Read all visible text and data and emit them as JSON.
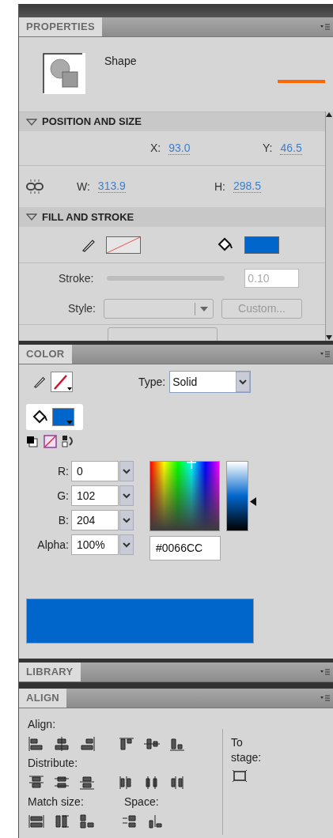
{
  "properties": {
    "tab": "PROPERTIES",
    "shape_label": "Shape",
    "position": {
      "title": "POSITION AND SIZE",
      "fields": [
        {
          "label": "X:",
          "value": "93.0"
        },
        {
          "label": "Y:",
          "value": "46.5"
        },
        {
          "label": "W:",
          "value": "313.9"
        },
        {
          "label": "H:",
          "value": "298.5"
        }
      ]
    },
    "fill_stroke": {
      "title": "FILL AND STROKE",
      "stroke_label": "Stroke:",
      "stroke_value": "0.10",
      "style_label": "Style:",
      "custom_button": "Custom..."
    }
  },
  "color": {
    "tab": "COLOR",
    "type_label": "Type:",
    "type_value": "Solid",
    "channels": [
      {
        "label": "R:",
        "value": "0"
      },
      {
        "label": "G:",
        "value": "102"
      },
      {
        "label": "B:",
        "value": "204"
      },
      {
        "label": "Alpha:",
        "value": "100%"
      }
    ],
    "hex": "#0066CC",
    "brightness": {
      "level": 0.42
    }
  },
  "library": {
    "tab": "LIBRARY"
  },
  "align": {
    "tab": "ALIGN",
    "align_label": "Align:",
    "distribute_label": "Distribute:",
    "match_size_label": "Match size:",
    "space_label": "Space:",
    "to_stage_label": "To stage:"
  }
}
